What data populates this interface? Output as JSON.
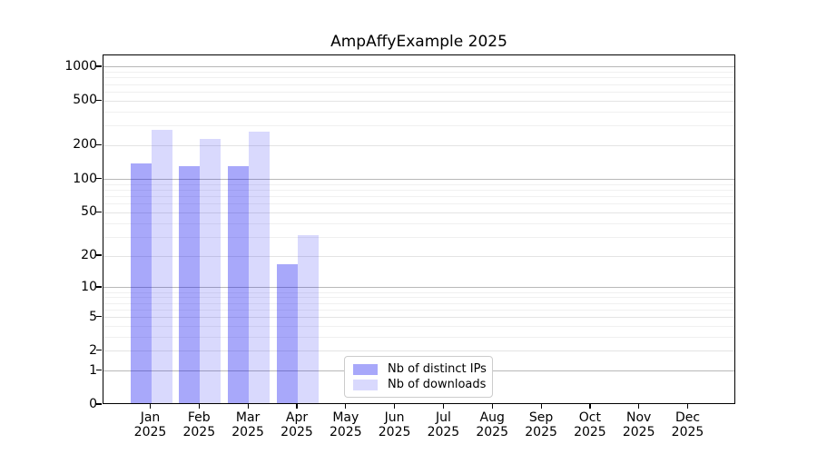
{
  "chart_data": {
    "type": "bar",
    "title": "AmpAffyExample 2025",
    "categories": [
      "Jan",
      "Feb",
      "Mar",
      "Apr",
      "May",
      "Jun",
      "Jul",
      "Aug",
      "Sep",
      "Oct",
      "Nov",
      "Dec"
    ],
    "category_year": "2025",
    "series": [
      {
        "name": "Nb of distinct IPs",
        "color": "rgba(0,0,240,0.34)",
        "values": [
          134,
          126,
          126,
          16,
          0,
          0,
          0,
          0,
          0,
          0,
          0,
          0
        ]
      },
      {
        "name": "Nb of downloads",
        "color": "rgba(0,0,240,0.15)",
        "values": [
          265,
          220,
          258,
          30,
          0,
          0,
          0,
          0,
          0,
          0,
          0,
          0
        ]
      }
    ],
    "yscale": "log10(value+1)",
    "y_ticks": [
      1000,
      500,
      200,
      100,
      50,
      20,
      10,
      5,
      2,
      1,
      0
    ],
    "ylim": [
      0,
      1150
    ],
    "grid": "horizontal",
    "legend_position": "inside-bottom-center"
  },
  "colors": {
    "background": "#ffffff",
    "axis": "#000000",
    "grid_decade": "#b8b8b8",
    "grid_labeled": "#e4e4e4",
    "grid_minor": "#f0f0f0",
    "legend_border": "#cccccc"
  }
}
